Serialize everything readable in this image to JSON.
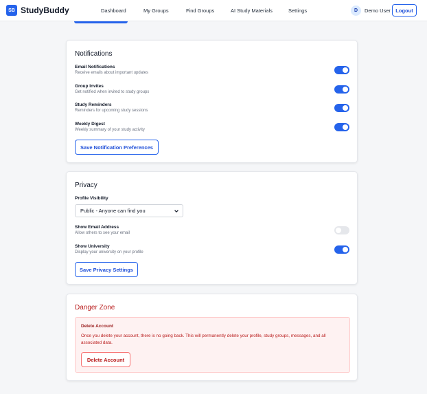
{
  "brand": {
    "badge": "SB",
    "name": "StudyBuddy"
  },
  "nav": {
    "items": [
      {
        "label": "Dashboard"
      },
      {
        "label": "My Groups"
      },
      {
        "label": "Find Groups"
      },
      {
        "label": "AI Study Materials"
      },
      {
        "label": "Settings"
      }
    ]
  },
  "user": {
    "initial": "D",
    "name": "Demo User",
    "logout_label": "Logout"
  },
  "notifications": {
    "title": "Notifications",
    "items": [
      {
        "label": "Email Notifications",
        "desc": "Receive emails about important updates",
        "enabled": true
      },
      {
        "label": "Group Invites",
        "desc": "Get notified when invited to study groups",
        "enabled": true
      },
      {
        "label": "Study Reminders",
        "desc": "Reminders for upcoming study sessions",
        "enabled": true
      },
      {
        "label": "Weekly Digest",
        "desc": "Weekly summary of your study activity",
        "enabled": true
      }
    ],
    "save_label": "Save Notification Preferences"
  },
  "privacy": {
    "title": "Privacy",
    "visibility_label": "Profile Visibility",
    "visibility_value": "Public - Anyone can find you",
    "items": [
      {
        "label": "Show Email Address",
        "desc": "Allow others to see your email",
        "enabled": false
      },
      {
        "label": "Show University",
        "desc": "Display your university on your profile",
        "enabled": true
      }
    ],
    "save_label": "Save Privacy Settings"
  },
  "danger": {
    "title": "Danger Zone",
    "label": "Delete Account",
    "desc": "Once you delete your account, there is no going back. This will permanently delete your profile, study groups, messages, and all associated data.",
    "button_label": "Delete Account"
  },
  "colors": {
    "accent": "#2563eb",
    "danger": "#b91c1c",
    "danger_bg": "#fef2f2"
  }
}
